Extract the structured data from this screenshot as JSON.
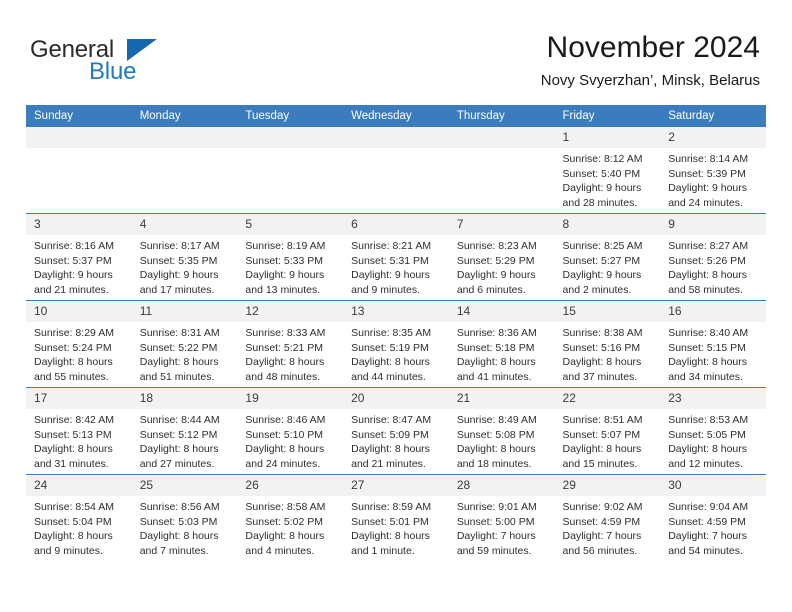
{
  "brand": {
    "word_one": "General",
    "word_two": "Blue",
    "accent_color": "#1567b0",
    "triangle_icon": "brand-triangle-icon"
  },
  "header": {
    "title": "November 2024",
    "subtitle": "Novy Svyerzhan’, Minsk, Belarus"
  },
  "theme": {
    "header_bar": "#3a7cbe",
    "row_rule": "#3a7cbe",
    "daynum_band": "#f2f2f2",
    "text": "#2e2e2e"
  },
  "weekdays": [
    "Sunday",
    "Monday",
    "Tuesday",
    "Wednesday",
    "Thursday",
    "Friday",
    "Saturday"
  ],
  "weeks": [
    [
      {
        "day": "",
        "lines": []
      },
      {
        "day": "",
        "lines": []
      },
      {
        "day": "",
        "lines": []
      },
      {
        "day": "",
        "lines": []
      },
      {
        "day": "",
        "lines": []
      },
      {
        "day": "1",
        "lines": [
          "Sunrise: 8:12 AM",
          "Sunset: 5:40 PM",
          "Daylight: 9 hours",
          "and 28 minutes."
        ]
      },
      {
        "day": "2",
        "lines": [
          "Sunrise: 8:14 AM",
          "Sunset: 5:39 PM",
          "Daylight: 9 hours",
          "and 24 minutes."
        ]
      }
    ],
    [
      {
        "day": "3",
        "lines": [
          "Sunrise: 8:16 AM",
          "Sunset: 5:37 PM",
          "Daylight: 9 hours",
          "and 21 minutes."
        ]
      },
      {
        "day": "4",
        "lines": [
          "Sunrise: 8:17 AM",
          "Sunset: 5:35 PM",
          "Daylight: 9 hours",
          "and 17 minutes."
        ]
      },
      {
        "day": "5",
        "lines": [
          "Sunrise: 8:19 AM",
          "Sunset: 5:33 PM",
          "Daylight: 9 hours",
          "and 13 minutes."
        ]
      },
      {
        "day": "6",
        "lines": [
          "Sunrise: 8:21 AM",
          "Sunset: 5:31 PM",
          "Daylight: 9 hours",
          "and 9 minutes."
        ]
      },
      {
        "day": "7",
        "lines": [
          "Sunrise: 8:23 AM",
          "Sunset: 5:29 PM",
          "Daylight: 9 hours",
          "and 6 minutes."
        ]
      },
      {
        "day": "8",
        "lines": [
          "Sunrise: 8:25 AM",
          "Sunset: 5:27 PM",
          "Daylight: 9 hours",
          "and 2 minutes."
        ]
      },
      {
        "day": "9",
        "lines": [
          "Sunrise: 8:27 AM",
          "Sunset: 5:26 PM",
          "Daylight: 8 hours",
          "and 58 minutes."
        ]
      }
    ],
    [
      {
        "day": "10",
        "lines": [
          "Sunrise: 8:29 AM",
          "Sunset: 5:24 PM",
          "Daylight: 8 hours",
          "and 55 minutes."
        ]
      },
      {
        "day": "11",
        "lines": [
          "Sunrise: 8:31 AM",
          "Sunset: 5:22 PM",
          "Daylight: 8 hours",
          "and 51 minutes."
        ]
      },
      {
        "day": "12",
        "lines": [
          "Sunrise: 8:33 AM",
          "Sunset: 5:21 PM",
          "Daylight: 8 hours",
          "and 48 minutes."
        ]
      },
      {
        "day": "13",
        "lines": [
          "Sunrise: 8:35 AM",
          "Sunset: 5:19 PM",
          "Daylight: 8 hours",
          "and 44 minutes."
        ]
      },
      {
        "day": "14",
        "lines": [
          "Sunrise: 8:36 AM",
          "Sunset: 5:18 PM",
          "Daylight: 8 hours",
          "and 41 minutes."
        ]
      },
      {
        "day": "15",
        "lines": [
          "Sunrise: 8:38 AM",
          "Sunset: 5:16 PM",
          "Daylight: 8 hours",
          "and 37 minutes."
        ]
      },
      {
        "day": "16",
        "lines": [
          "Sunrise: 8:40 AM",
          "Sunset: 5:15 PM",
          "Daylight: 8 hours",
          "and 34 minutes."
        ]
      }
    ],
    [
      {
        "day": "17",
        "lines": [
          "Sunrise: 8:42 AM",
          "Sunset: 5:13 PM",
          "Daylight: 8 hours",
          "and 31 minutes."
        ]
      },
      {
        "day": "18",
        "lines": [
          "Sunrise: 8:44 AM",
          "Sunset: 5:12 PM",
          "Daylight: 8 hours",
          "and 27 minutes."
        ]
      },
      {
        "day": "19",
        "lines": [
          "Sunrise: 8:46 AM",
          "Sunset: 5:10 PM",
          "Daylight: 8 hours",
          "and 24 minutes."
        ]
      },
      {
        "day": "20",
        "lines": [
          "Sunrise: 8:47 AM",
          "Sunset: 5:09 PM",
          "Daylight: 8 hours",
          "and 21 minutes."
        ]
      },
      {
        "day": "21",
        "lines": [
          "Sunrise: 8:49 AM",
          "Sunset: 5:08 PM",
          "Daylight: 8 hours",
          "and 18 minutes."
        ]
      },
      {
        "day": "22",
        "lines": [
          "Sunrise: 8:51 AM",
          "Sunset: 5:07 PM",
          "Daylight: 8 hours",
          "and 15 minutes."
        ]
      },
      {
        "day": "23",
        "lines": [
          "Sunrise: 8:53 AM",
          "Sunset: 5:05 PM",
          "Daylight: 8 hours",
          "and 12 minutes."
        ]
      }
    ],
    [
      {
        "day": "24",
        "lines": [
          "Sunrise: 8:54 AM",
          "Sunset: 5:04 PM",
          "Daylight: 8 hours",
          "and 9 minutes."
        ]
      },
      {
        "day": "25",
        "lines": [
          "Sunrise: 8:56 AM",
          "Sunset: 5:03 PM",
          "Daylight: 8 hours",
          "and 7 minutes."
        ]
      },
      {
        "day": "26",
        "lines": [
          "Sunrise: 8:58 AM",
          "Sunset: 5:02 PM",
          "Daylight: 8 hours",
          "and 4 minutes."
        ]
      },
      {
        "day": "27",
        "lines": [
          "Sunrise: 8:59 AM",
          "Sunset: 5:01 PM",
          "Daylight: 8 hours",
          "and 1 minute."
        ]
      },
      {
        "day": "28",
        "lines": [
          "Sunrise: 9:01 AM",
          "Sunset: 5:00 PM",
          "Daylight: 7 hours",
          "and 59 minutes."
        ]
      },
      {
        "day": "29",
        "lines": [
          "Sunrise: 9:02 AM",
          "Sunset: 4:59 PM",
          "Daylight: 7 hours",
          "and 56 minutes."
        ]
      },
      {
        "day": "30",
        "lines": [
          "Sunrise: 9:04 AM",
          "Sunset: 4:59 PM",
          "Daylight: 7 hours",
          "and 54 minutes."
        ]
      }
    ]
  ]
}
